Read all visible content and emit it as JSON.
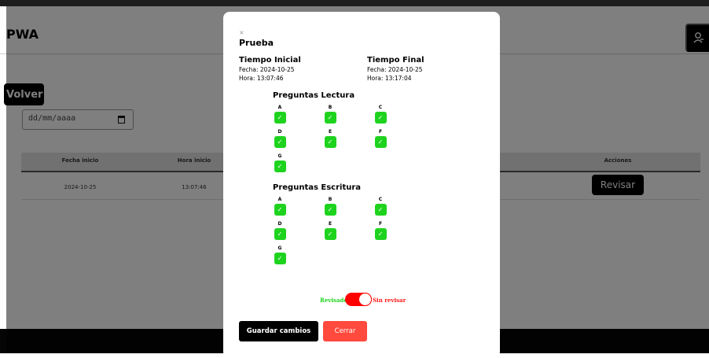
{
  "header": {
    "title": "PWA",
    "profile_icon": "user-icon"
  },
  "toolbar": {
    "back_label": "Volver"
  },
  "filter": {
    "date_placeholder": "dd/mm/aaaa",
    "calendar_icon": "calendar-icon"
  },
  "table": {
    "headers": [
      "Fecha inicio",
      "Hora inicio",
      "Acciones"
    ],
    "rows": [
      {
        "fecha": "2024-10-25",
        "hora": "13:07:46",
        "action_label": "Revisar"
      }
    ]
  },
  "modal": {
    "close_glyph": "×",
    "title": "Prueba",
    "initial": {
      "heading": "Tiempo Inicial",
      "date": "Fecha: 2024-10-25",
      "time": "Hora: 13:07:46"
    },
    "final": {
      "heading": "Tiempo Final",
      "date": "Fecha: 2024-10-25",
      "time": "Hora: 13:17:04"
    },
    "lectura": {
      "title": "Preguntas Lectura",
      "items": [
        {
          "letter": "A",
          "checked": true
        },
        {
          "letter": "B",
          "checked": true
        },
        {
          "letter": "C",
          "checked": true
        },
        {
          "letter": "D",
          "checked": true
        },
        {
          "letter": "E",
          "checked": true
        },
        {
          "letter": "F",
          "checked": true
        },
        {
          "letter": "G",
          "checked": true
        }
      ]
    },
    "escritura": {
      "title": "Preguntas Escritura",
      "items": [
        {
          "letter": "A",
          "checked": true
        },
        {
          "letter": "B",
          "checked": true
        },
        {
          "letter": "C",
          "checked": true
        },
        {
          "letter": "D",
          "checked": true
        },
        {
          "letter": "E",
          "checked": true
        },
        {
          "letter": "F",
          "checked": true
        },
        {
          "letter": "G",
          "checked": true
        }
      ]
    },
    "check_glyph": "✓",
    "toggle": {
      "left_label": "Revisado",
      "right_label": "Sin revisar",
      "state": "sin revisar"
    },
    "save_label": "Guardar cambios",
    "close_label": "Cerrar"
  },
  "colors": {
    "check_green": "#1ed31e",
    "toggle_red": "#ff0000",
    "close_button": "#ff4a3d"
  }
}
